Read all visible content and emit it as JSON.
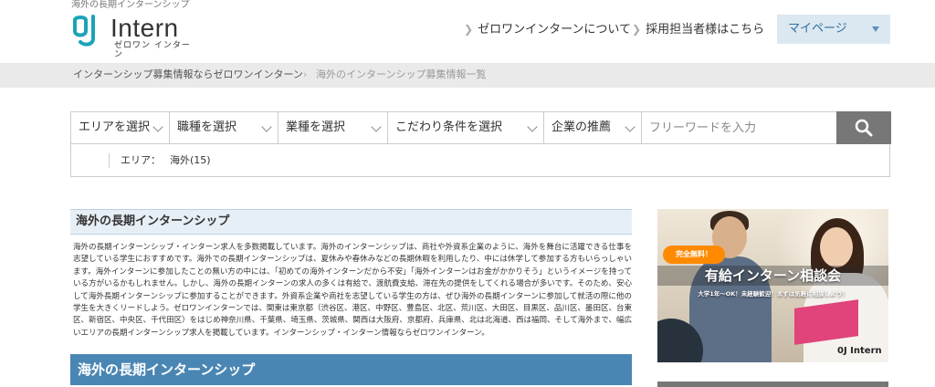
{
  "header": {
    "tagline": "海外の長期インターンシップ",
    "logo_word": "Intern",
    "logo_sub": "ゼロワン インターン",
    "nav": [
      {
        "label": "ゼロワンインターンについて"
      },
      {
        "label": "採用担当者様はこちら"
      }
    ],
    "mypage_label": "マイページ"
  },
  "breadcrumb": {
    "home": "インターンシップ募集情報ならゼロワンインターン",
    "separator": "›",
    "current": "海外のインターンシップ募集情報一覧"
  },
  "search": {
    "selects": [
      {
        "label": "エリアを選択"
      },
      {
        "label": "職種を選択"
      },
      {
        "label": "業種を選択"
      },
      {
        "label": "こだわり条件を選択"
      },
      {
        "label": "企業の推薦"
      }
    ],
    "freeword_placeholder": "フリーワードを入力"
  },
  "filter": {
    "label": "エリア：",
    "value": "海外(15)"
  },
  "main": {
    "section_title": "海外の長期インターンシップ",
    "description": "海外の長期インターンシップ・インターン求人を多数掲載しています。海外のインターンシップは、商社や外資系企業のように、海外を舞台に活躍できる仕事を志望している学生におすすめです。海外での長期インターンシップは、夏休みや春休みなどの長期休暇を利用したり、中には休学して参加する方もいらっしゃいます。海外インターンに参加したことの無い方の中には、「初めての海外インターンだから不安」「海外インターンはお金がかかりそう」というイメージを持っている方がいるかもしれません。しかし、海外の長期インターンの求人の多くは有給で、渡航費支給、滞在先の提供をしてくれる場合が多いです。そのため、安心して海外長期インターンシップに参加することができます。外資系企業や商社を志望している学生の方は、ぜひ海外の長期インターンに参加して就活の際に他の学生を大きくリードしよう。ゼロワンインターンでは、関東は東京都（渋谷区、港区、中野区、豊島区、北区、荒川区、大田区、目黒区、品川区、墨田区、台東区、新宿区、中央区、千代田区）をはじめ神奈川県、千葉県、埼玉県、茨城県、関西は大阪府、京都府、兵庫県、北は北海道、西は福岡、そして海外まで、幅広いエリアの長期インターンシップ求人を掲載しています。インターンシップ・インターン情報ならゼロワンインターン。",
    "blue_heading": "海外の長期インターンシップ"
  },
  "banner": {
    "badge": "完全無料！",
    "title": "有給インターン相談会",
    "subtitle": "大学1年〜OK！未経験歓迎！まずは気軽に相談しよう！",
    "logo": "Intern"
  },
  "colors": {
    "accent": "#4a86b3",
    "logo_teal": "#1aa3b8",
    "mypage_bg": "#dbe8f1",
    "search_button": "#777777",
    "badge": "#ff8a00"
  }
}
